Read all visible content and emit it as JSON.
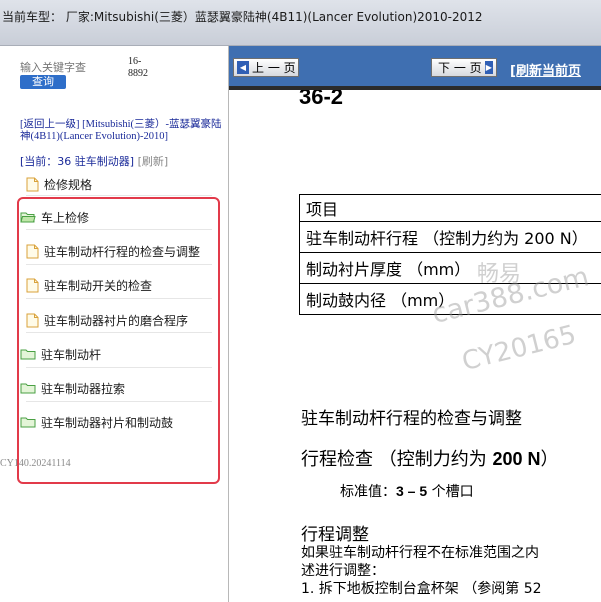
{
  "window": {
    "title": "当前车型： 厂家:Mitsubishi(三菱）蓝瑟翼豪陆神(4B11)(Lancer Evolution)2010-2012"
  },
  "sidebar": {
    "search_placeholder": "输入关键字查",
    "search_button": "查询",
    "page_range": "16-8892",
    "back_link": "[返回上一级]",
    "model_link": "[Mitsubishi(三菱）-蓝瑟翼豪陆神(4B11)(Lancer Evolution)-2010]",
    "current_prefix": "[当前：",
    "current_value": "36 驻车制动器",
    "current_suffix": "]",
    "refresh_link": "[刷新]",
    "items": [
      {
        "label": "检修规格",
        "icon": "doc-icon"
      },
      {
        "label": "车上检修",
        "icon": "folder-open-icon"
      },
      {
        "label": "驻车制动杆行程的检查与调整",
        "icon": "doc-icon"
      },
      {
        "label": "驻车制动开关的检查",
        "icon": "doc-icon"
      },
      {
        "label": "驻车制动器衬片的磨合程序",
        "icon": "doc-icon"
      },
      {
        "label": "驻车制动杆",
        "icon": "folder-icon"
      },
      {
        "label": "驻车制动器拉索",
        "icon": "folder-icon"
      },
      {
        "label": "驻车制动器衬片和制动鼓",
        "icon": "folder-icon"
      }
    ],
    "footer_code": "CY140.20241114",
    "highlight_color": "#e23a4a"
  },
  "toolbar": {
    "prev_label": "上 一 页",
    "next_label": "下 一 页",
    "refresh_label": "[刷新当前页",
    "background": "#3f6fb1"
  },
  "document": {
    "page_number": "36-2",
    "table": {
      "header": "项目",
      "rows": [
        "驻车制动杆行程 （控制力约为 200 N）",
        "制动衬片厚度 （mm）",
        "制动鼓内径 （mm）"
      ]
    },
    "watermark": {
      "line1": "畅易",
      "line2": "car388.com",
      "line3": "CY20165"
    },
    "section_title": "驻车制动杆行程的检查与调整",
    "check_heading_prefix": "行程检查 （控制力约为 ",
    "check_heading_bold": "200 N",
    "check_heading_suffix": "）",
    "standard_prefix": "标准值：",
    "standard_bold": "3 – 5",
    "standard_suffix": " 个槽口",
    "adjust_heading": "行程调整",
    "adjust_body_line1": "如果驻车制动杆行程不在标准范围之内",
    "adjust_body_line2": "述进行调整：",
    "adjust_step1": "1. 拆下地板控制台盒杯架 （参阅第 52"
  }
}
